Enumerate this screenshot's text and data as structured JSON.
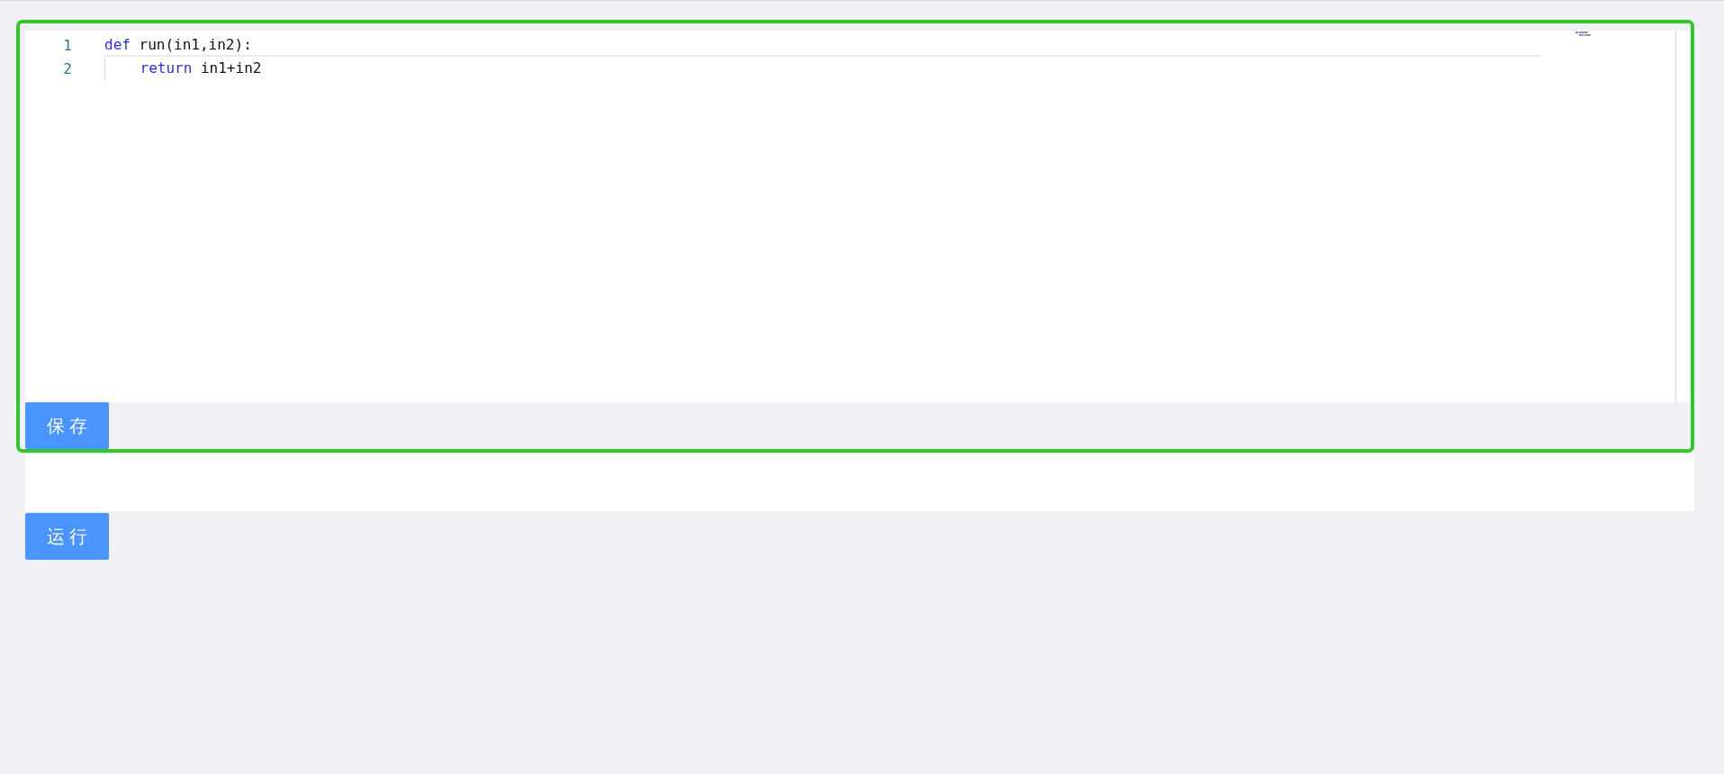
{
  "editor": {
    "focused": true,
    "lines": [
      {
        "number": "1",
        "current": true,
        "tokens": [
          {
            "kind": "keyword",
            "text": "def"
          },
          {
            "kind": "plain",
            "text": " run(in1,in2):"
          }
        ]
      },
      {
        "number": "2",
        "current": false,
        "tokens": [
          {
            "kind": "keyword",
            "text": "    return"
          },
          {
            "kind": "plain",
            "text": " in1+in2"
          }
        ]
      }
    ],
    "save_button": "保存"
  },
  "run_button": "运行"
}
